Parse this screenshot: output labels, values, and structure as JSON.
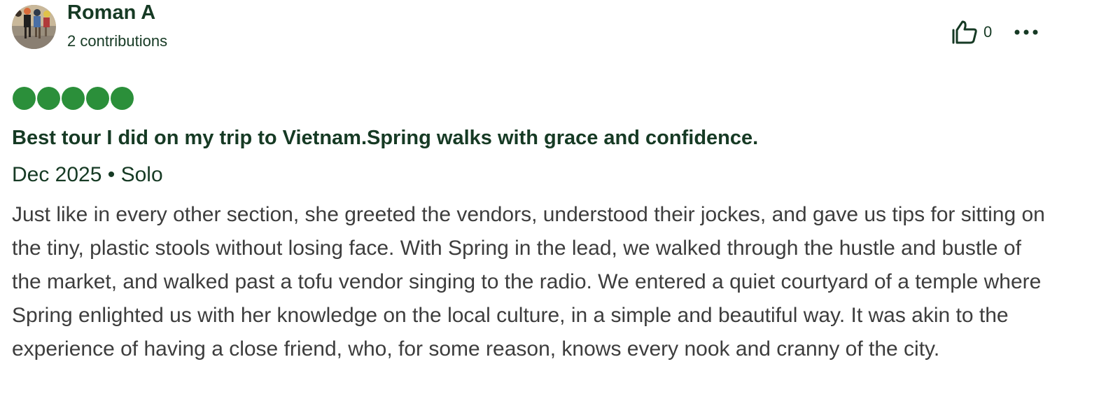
{
  "review": {
    "author": {
      "name": "Roman A",
      "contributions": "2 contributions",
      "avatar_icon": "runners-photo-avatar"
    },
    "actions": {
      "helpful_icon": "thumbs-up-icon",
      "helpful_count": "0",
      "more_icon": "ellipsis-icon"
    },
    "rating": {
      "value": 5,
      "max": 5,
      "color": "#2b8f3a"
    },
    "title": "Best tour I did on my trip to Vietnam.Spring walks with grace and confidence.",
    "trip_meta": "Dec 2025 • Solo",
    "body": "Just like in every other section, she greeted the vendors, understood their jockes, and gave us tips for sitting on the tiny, plastic stools without losing face. With Spring in the lead, we walked through the hustle and bustle of the market, and walked past a tofu vendor singing to the radio. We entered a quiet courtyard of a temple where Spring enlighted us with her knowledge on the local culture, in a simple and beautiful way. It was akin to the experience of having a close friend, who, for some reason, knows every nook and cranny of the city."
  },
  "colors": {
    "heading": "#163a24",
    "body_text": "#3d3d3d",
    "rating_bubble": "#2b8f3a"
  }
}
